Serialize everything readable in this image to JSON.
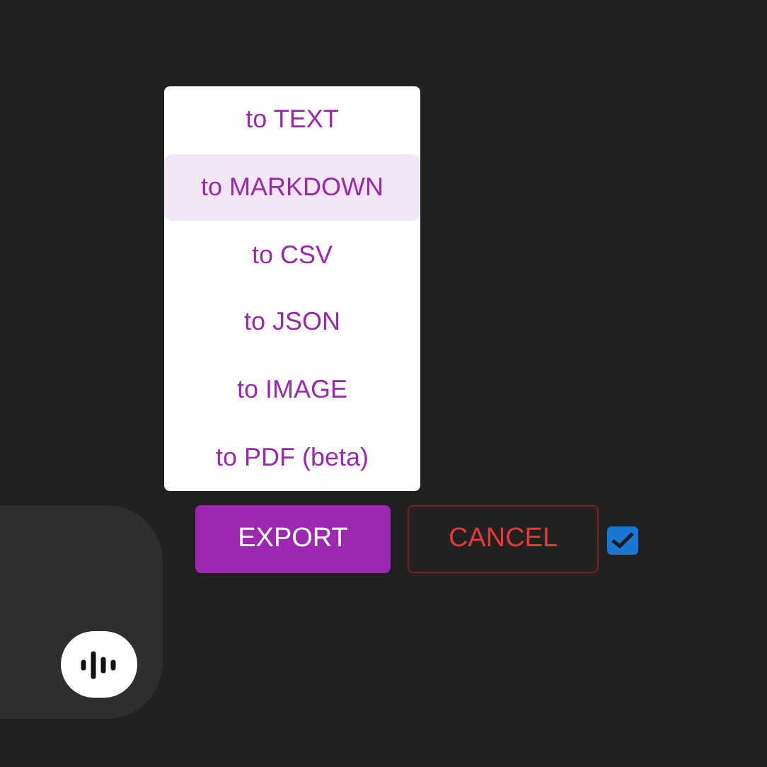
{
  "menu": {
    "items": [
      {
        "label": "to TEXT",
        "selected": false
      },
      {
        "label": "to MARKDOWN",
        "selected": true
      },
      {
        "label": "to CSV",
        "selected": false
      },
      {
        "label": "to JSON",
        "selected": false
      },
      {
        "label": "to IMAGE",
        "selected": false
      },
      {
        "label": "to PDF (beta)",
        "selected": false
      }
    ]
  },
  "buttons": {
    "export": "EXPORT",
    "cancel": "CANCEL"
  },
  "checkbox": {
    "checked": true
  }
}
